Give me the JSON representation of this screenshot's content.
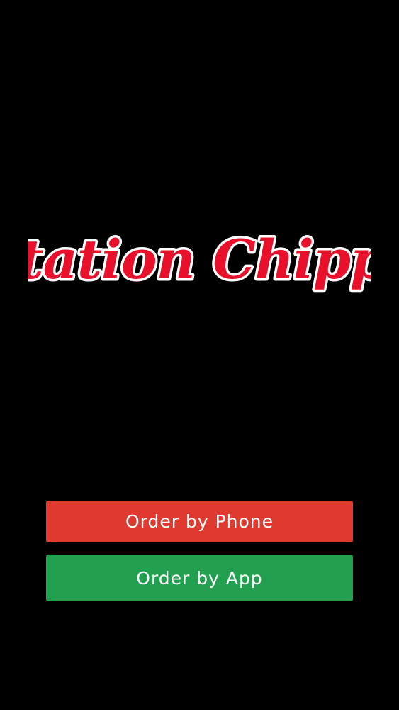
{
  "app": {
    "logo_text": "Station Chippy"
  },
  "buttons": {
    "phone": {
      "label": "Order by Phone"
    },
    "app": {
      "label": "Order by App"
    }
  },
  "colors": {
    "background": "#000000",
    "logo_fill": "#e8102a",
    "logo_outline": "#ffffff",
    "phone_button": "#e0392f",
    "app_button": "#22a04f",
    "button_text": "#ffffff"
  }
}
